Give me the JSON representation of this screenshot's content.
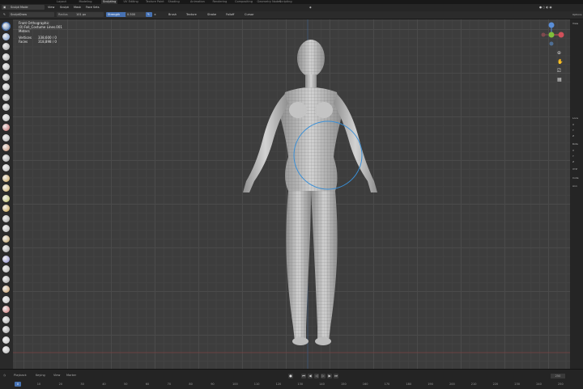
{
  "topbar": {
    "tabs": [
      "Layout",
      "Modeling",
      "Sculpting",
      "UV Editing",
      "Texture Paint",
      "Shading",
      "Animation",
      "Rendering",
      "Compositing",
      "Geometry Nodes",
      "Scripting"
    ],
    "active_tab": "Sculpting"
  },
  "header": {
    "mode": "Sculpt Mode",
    "menus": [
      "View",
      "Sculpt",
      "Mask",
      "Face Sets"
    ]
  },
  "toolsettings": {
    "brush": "SculptDraw",
    "radius_label": "Radius",
    "radius_value": "101 px",
    "strength_label": "Strength",
    "strength_value": "0.500",
    "dropdowns": [
      "Brush",
      "Texture",
      "Stroke",
      "Falloff",
      "Cursor"
    ]
  },
  "overlay": {
    "view_name": "Front Orthographic",
    "object_name": "(0) Fall_Costume Lines.001",
    "units": "Meters",
    "vertices_label": "Vertices",
    "vertices_value": "338,600 / 0",
    "faces_label": "Faces",
    "faces_value": "318,898 / 0"
  },
  "rightpanel": {
    "tab_label": "Options",
    "items": [
      "View",
      "Loca",
      "X",
      "Y",
      "Z",
      "Rota",
      "X",
      "Y",
      "Z",
      "XYZ",
      "Colle",
      "Ann"
    ]
  },
  "timeline": {
    "menus": [
      "Playback",
      "Keying",
      "View",
      "Marker"
    ],
    "current_frame": "0",
    "end_frame": "250",
    "ticks": [
      "0",
      "10",
      "20",
      "30",
      "40",
      "50",
      "60",
      "70",
      "80",
      "90",
      "100",
      "110",
      "120",
      "130",
      "140",
      "150",
      "160",
      "170",
      "180",
      "190",
      "200",
      "210",
      "220",
      "230",
      "240",
      "250"
    ]
  },
  "colors": {
    "accent": "#4772b3",
    "brush_circle": "#3a8fd6",
    "viewport_bg": "#3d3d3d"
  }
}
